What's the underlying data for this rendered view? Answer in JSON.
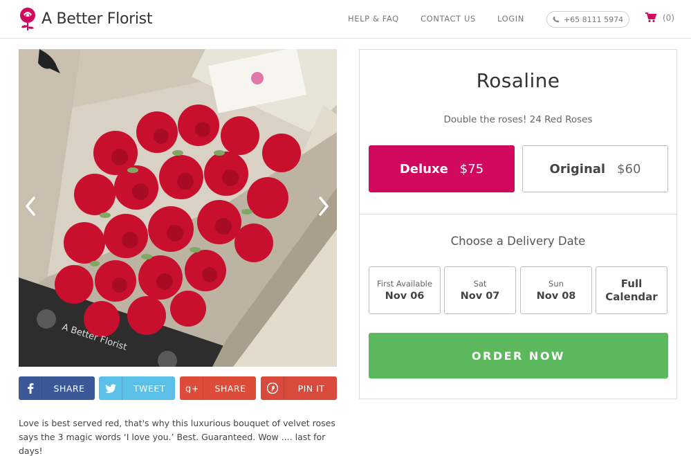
{
  "brand": {
    "name": "A Better Florist",
    "color": "#d0095e"
  },
  "nav": {
    "help": "HELP & FAQ",
    "contact": "CONTACT US",
    "login": "LOGIN",
    "phone": "+65 8111 5974",
    "cart_count": "(0)"
  },
  "gallery": {
    "box_brand": "A Better Florist",
    "prev_icon": "chevron-left-icon",
    "next_icon": "chevron-right-icon"
  },
  "share": {
    "facebook": "SHARE",
    "twitter": "TWEET",
    "googleplus": "SHARE",
    "pinterest": "PIN IT",
    "colors": {
      "facebook": "#3b5998",
      "twitter": "#5bc0e8",
      "googleplus": "#dd4b39",
      "pinterest": "#d74a3c"
    }
  },
  "description": "Love is best served red, that's why this luxurious bouquet of velvet roses says the 3 magic words ‘I love you.’ Best. Guaranteed. Wow .... last for days!",
  "product": {
    "title": "Rosaline",
    "subtitle": "Double the roses! 24 Red Roses",
    "variants": [
      {
        "name": "Deluxe",
        "price": "$75",
        "selected": true
      },
      {
        "name": "Original",
        "price": "$60",
        "selected": false
      }
    ]
  },
  "delivery": {
    "title": "Choose a Delivery Date",
    "dates": [
      {
        "label": "First Available",
        "value": "Nov 06"
      },
      {
        "label": "Sat",
        "value": "Nov 07"
      },
      {
        "label": "Sun",
        "value": "Nov 08"
      }
    ],
    "calendar_line1": "Full",
    "calendar_line2": "Calendar"
  },
  "order": {
    "label": "ORDER NOW",
    "color": "#5cb85c"
  }
}
